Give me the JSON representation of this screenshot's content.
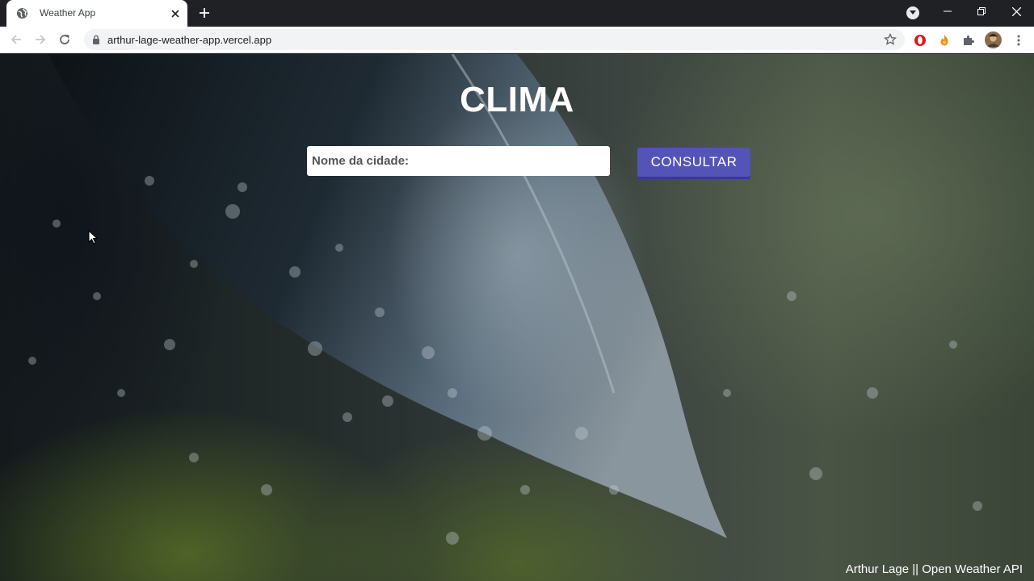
{
  "browser": {
    "tab_title": "Weather App",
    "url": "arthur-lage-weather-app.vercel.app"
  },
  "app": {
    "title": "CLIMA",
    "city_placeholder": "Nome da cidade:",
    "city_value": "",
    "submit_label": "CONSULTAR",
    "footer": "Arthur Lage || Open Weather API"
  },
  "colors": {
    "button": "#5353b8",
    "chrome_dark": "#202124"
  },
  "icons": [
    "globe-icon",
    "close-icon",
    "plus-icon",
    "tab-search-icon",
    "minimize-icon",
    "restore-icon",
    "close-window-icon",
    "back-icon",
    "forward-icon",
    "reload-icon",
    "lock-icon",
    "star-icon",
    "opera-icon",
    "fire-icon",
    "puzzle-icon",
    "avatar",
    "menu-icon",
    "cursor-icon"
  ]
}
